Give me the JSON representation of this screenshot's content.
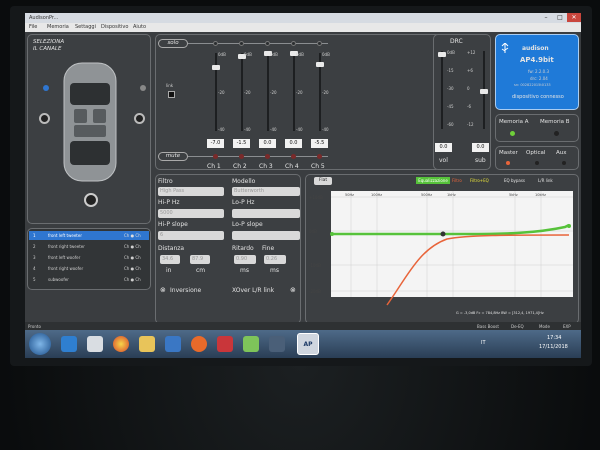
{
  "window": {
    "title": "AudisonPr...",
    "controls": [
      "–",
      "□",
      "✕"
    ]
  },
  "menu": [
    "File",
    "Memoria",
    "Settaggi",
    "Dispositivo",
    "Aiuto"
  ],
  "channel_select": {
    "title_line1": "SELEZIONA",
    "title_line2": "IL CANALE"
  },
  "channels_list": [
    {
      "num": "1",
      "name": "front left tweeter",
      "tag": "Ch ● Ch",
      "color": "#2f76d0"
    },
    {
      "num": "2",
      "name": "front right tweeter",
      "tag": "Ch ● Ch",
      "color": ""
    },
    {
      "num": "3",
      "name": "front left woofer",
      "tag": "Ch ● Ch",
      "color": ""
    },
    {
      "num": "4",
      "name": "front right woofer",
      "tag": "Ch ● Ch",
      "color": ""
    },
    {
      "num": "5",
      "name": "subwoofer",
      "tag": "Ch ● Ch",
      "color": ""
    }
  ],
  "mixer": {
    "solo_label": "solo",
    "mute_label": "mute",
    "link_label": "link",
    "db_ticks": [
      "0dB",
      "-20",
      "-40"
    ],
    "channels": [
      {
        "label": "Ch 1",
        "value": "-7.0",
        "level": -7.0
      },
      {
        "label": "Ch 2",
        "value": "-1.5",
        "level": -1.5
      },
      {
        "label": "Ch 3",
        "value": "0.0",
        "level": 0.0
      },
      {
        "label": "Ch 4",
        "value": "0.0",
        "level": 0.0
      },
      {
        "label": "Ch 5",
        "value": "-5.5",
        "level": -5.5
      }
    ]
  },
  "drc": {
    "title": "DRC",
    "vol_ticks": [
      "0dB",
      "-15",
      "-30",
      "-45",
      "-60"
    ],
    "sub_ticks": [
      "+12",
      "+6",
      "0",
      "-6",
      "-12"
    ],
    "vol_value": "0.0",
    "sub_value": "0.0",
    "vol_label": "vol",
    "sub_label": "sub"
  },
  "device": {
    "brand": "audison",
    "model": "AP4.9bit",
    "fw": "fw: 2.2.0.3",
    "drc": "drc: 2.04",
    "serial": "sn: 002822015t0133",
    "status": "dispositivo connesso"
  },
  "memory": {
    "a": "Memoria A",
    "b": "Memoria B"
  },
  "inputs": {
    "master": "Master",
    "optical": "Optical",
    "aux": "Aux"
  },
  "filter": {
    "filtro_label": "Filtro",
    "filtro_value": "High Pass",
    "modello_label": "Modello",
    "modello_value": "Butterworth",
    "hip_hz_label": "Hi-P Hz",
    "hip_hz_value": "5000",
    "lop_hz_label": "Lo-P Hz",
    "lop_hz_value": "",
    "hip_slope_label": "Hi-P slope",
    "hip_slope_value": "6",
    "lop_slope_label": "Lo-P slope",
    "lop_slope_value": "",
    "distanza_label": "Distanza",
    "distanza_in": "34.6",
    "distanza_cm": "87.9",
    "in_label": "in",
    "cm_label": "cm",
    "ritardo_label": "Ritardo",
    "ritardo_value": "0.90",
    "fine_label": "Fine",
    "fine_value": "0.26",
    "ms_label": "ms",
    "ms_label2": "ms",
    "inversione": "Inversione",
    "xover_link": "XOver L/R link"
  },
  "graph": {
    "flat_btn": "Flat",
    "equalizzazione": "Equalizzazione",
    "filtro_label": "Filtro",
    "filtro_eq": "Filtro+EQ",
    "eq_bypass": "EQ bypass",
    "lr_link": "L/R link",
    "y_ticks": [
      "+10dB",
      "0dB",
      "-10dB",
      "-20dB"
    ],
    "x_ticks": [
      "50Hz",
      "100Hz",
      "500Hz",
      "1kHz",
      "5kHz",
      "10kHz"
    ],
    "readout": "G = -3,0dB    Fc = 784,8Hz    BW = [312,4, 1971,4]Hz",
    "bass_boost": "Bass Boost",
    "de_eq": "De-EQ",
    "mode": "Mode",
    "exp": "EXP"
  },
  "status_bar": {
    "left": "Pronto"
  },
  "taskbar": {
    "lang": "IT",
    "time": "17:34",
    "date": "17/11/2018"
  },
  "colors": {
    "eq_green": "#56c23a",
    "filter_orange": "#e8643a",
    "device_blue": "#1f7ad8",
    "memory_a_dot": "#6fcf3a"
  }
}
